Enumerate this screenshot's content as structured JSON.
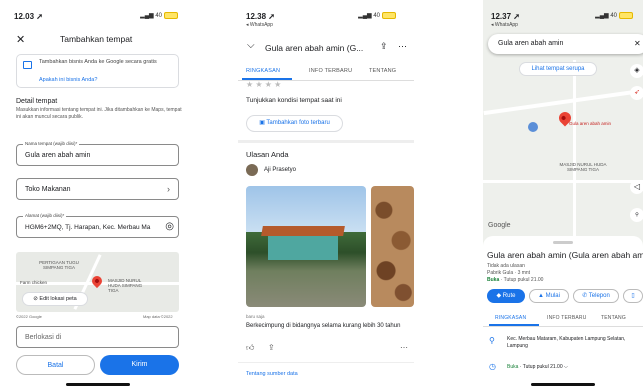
{
  "phone1": {
    "status_time": "12.03",
    "battery": "40",
    "title": "Tambahkan tempat",
    "promo_text": "Tambahkan bisnis Anda ke Google secara gratis",
    "promo_link": "Apakah ini bisnis Anda?",
    "section_title": "Detail tempat",
    "section_desc": "Masukkan informasi tentang tempat ini. Jika ditambahkan ke Maps, tempat ini akan muncul secara publik.",
    "name_label": "Nama tempat (wajib diisi)*",
    "name_value": "Gula aren abah amin",
    "category_value": "Toko Makanan",
    "address_label": "Alamat (wajib diisi)*",
    "address_value": "HGM6+2MQ, Tj. Harapan, Kec. Merbau Ma",
    "map_label1": "PERTIGAAN TUGU SIMPANG TIGA",
    "map_label2": "Farm chicken",
    "map_label3": "MASJID NURUL HUDA SIMPANG TIGA",
    "edit_map_button": "Edit lokasi peta",
    "map_footer_left": "©2022 Google",
    "map_footer_right": "Map data ©2022",
    "location_placeholder": "Berlokasi di",
    "cancel_button": "Batal",
    "submit_button": "Kirim"
  },
  "phone2": {
    "status_time": "12.38",
    "back_app": "◂ WhatsApp",
    "battery": "40",
    "title": "Gula aren abah amin (G...",
    "tabs": [
      "RINGKASAN",
      "INFO TERBARU",
      "TENTANG"
    ],
    "prompt": "Tunjukkan kondisi tempat saat ini",
    "add_photo_button": "Tambahkan foto terbaru",
    "reviews_title": "Ulasan Anda",
    "reviewer_name": "Aji Prasetyo",
    "photo_meta": "baru saja",
    "review_text": "Berkecimpung di bidangnya selama kurang lebih 30 tahun",
    "about_link": "Tentang sumber data"
  },
  "phone3": {
    "status_time": "12.37",
    "back_app": "◂ WhatsApp",
    "battery": "40",
    "search_value": "Gula aren abah amin",
    "see_place_chip": "Lihat tempat serupa",
    "map_pin_label": "Gula aren abah amin",
    "map_label": "MASJID NURUL HUDA SIMPANG TIGA",
    "google_logo": "Google",
    "place_title": "Gula aren abah amin (Gula aren abah am",
    "no_reviews": "Tidak ada ulasan",
    "category_line": "Pabrik Gula · 3 mnt",
    "hours_status": "Buka",
    "hours_rest": " · Tutup pukul 21.00",
    "route_button": "Rute",
    "start_button": "Mulai",
    "call_button": "Telepon",
    "tabs": [
      "RINGKASAN",
      "INFO TERBARU",
      "TENTANG"
    ],
    "address": "Kec. Merbau Mataram, Kabupaten Lampung Selatan, Lampung",
    "hours_row_status": "Buka",
    "hours_row_rest": " · Tutup pukul 21.00"
  }
}
